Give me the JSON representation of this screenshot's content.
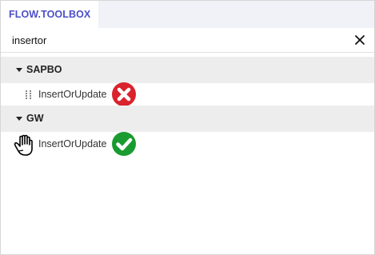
{
  "toolbox": {
    "tab_label": "FLOW.TOOLBOX"
  },
  "search": {
    "value": "insertor",
    "clear_icon": "close-icon"
  },
  "groups": [
    {
      "name": "SAPBO",
      "expanded": true,
      "items": [
        {
          "label": "InsertOrUpdate",
          "status_icon": "error-icon",
          "status_color": "#d9232d"
        }
      ]
    },
    {
      "name": "GW",
      "expanded": true,
      "items": [
        {
          "label": "InsertOrUpdate",
          "status_icon": "check-icon",
          "status_color": "#1a9b2f"
        }
      ]
    }
  ],
  "colors": {
    "tab_text": "#4b4fc9",
    "tab_strip_bg": "#f1f2f7",
    "group_header_bg": "#ededed"
  },
  "cursor_icon": "grab-hand-cursor-icon"
}
